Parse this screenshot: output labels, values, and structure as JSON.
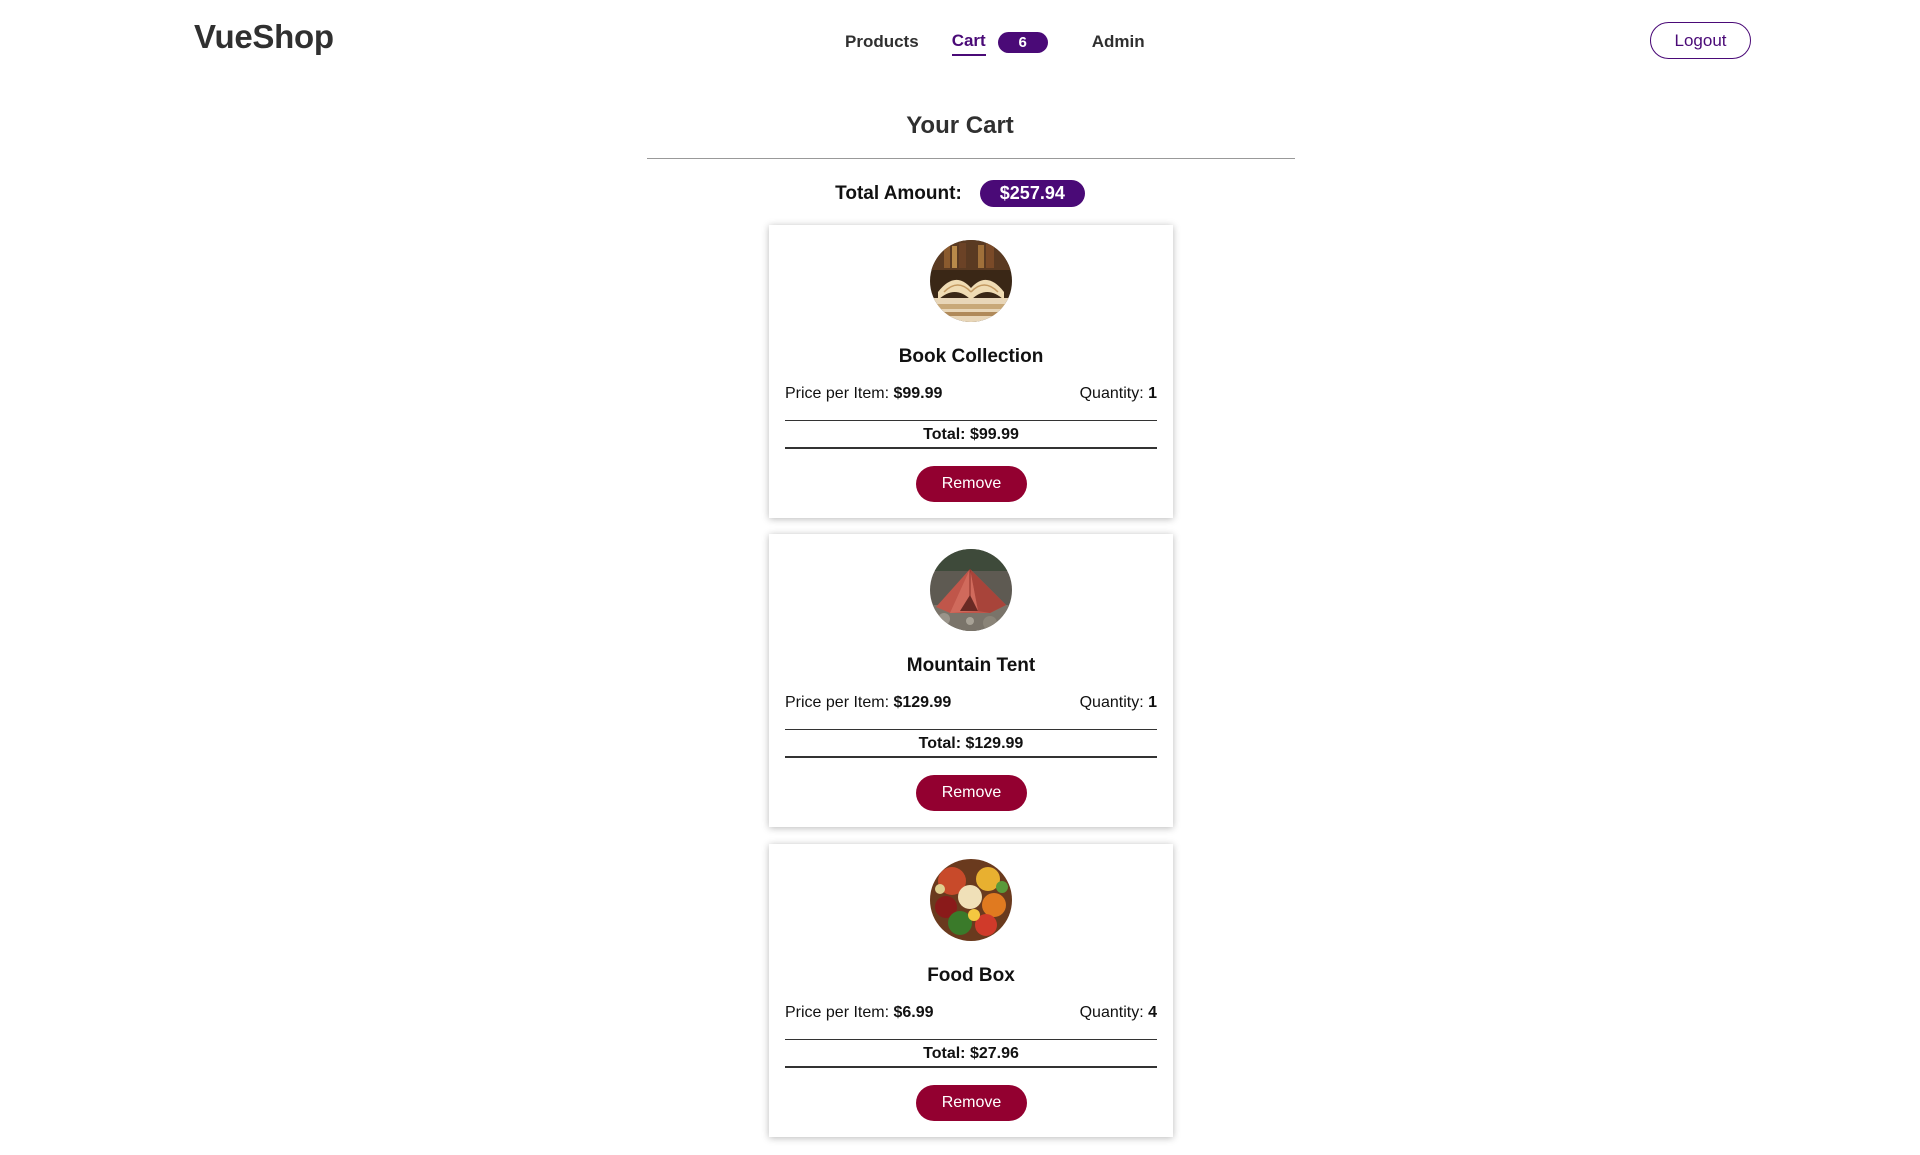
{
  "header": {
    "logo": "VueShop",
    "nav": {
      "products": "Products",
      "cart": "Cart",
      "cart_count": "6",
      "admin": "Admin"
    },
    "logout_label": "Logout"
  },
  "main": {
    "title": "Your Cart",
    "total_label": "Total Amount:",
    "total_value": "$257.94",
    "price_label": "Price per Item:",
    "quantity_label": "Quantity:",
    "subtotal_label": "Total:",
    "remove_label": "Remove",
    "items": [
      {
        "name": "Book Collection",
        "price": "$99.99",
        "quantity": "1",
        "total": "$99.99",
        "image_icon": "open-book-photo"
      },
      {
        "name": "Mountain Tent",
        "price": "$129.99",
        "quantity": "1",
        "total": "$129.99",
        "image_icon": "red-tent-photo"
      },
      {
        "name": "Food Box",
        "price": "$6.99",
        "quantity": "4",
        "total": "$27.96",
        "image_icon": "vegetables-photo"
      }
    ]
  },
  "colors": {
    "accent": "#4a0a77",
    "remove": "#930030",
    "text_dark": "#303030"
  }
}
